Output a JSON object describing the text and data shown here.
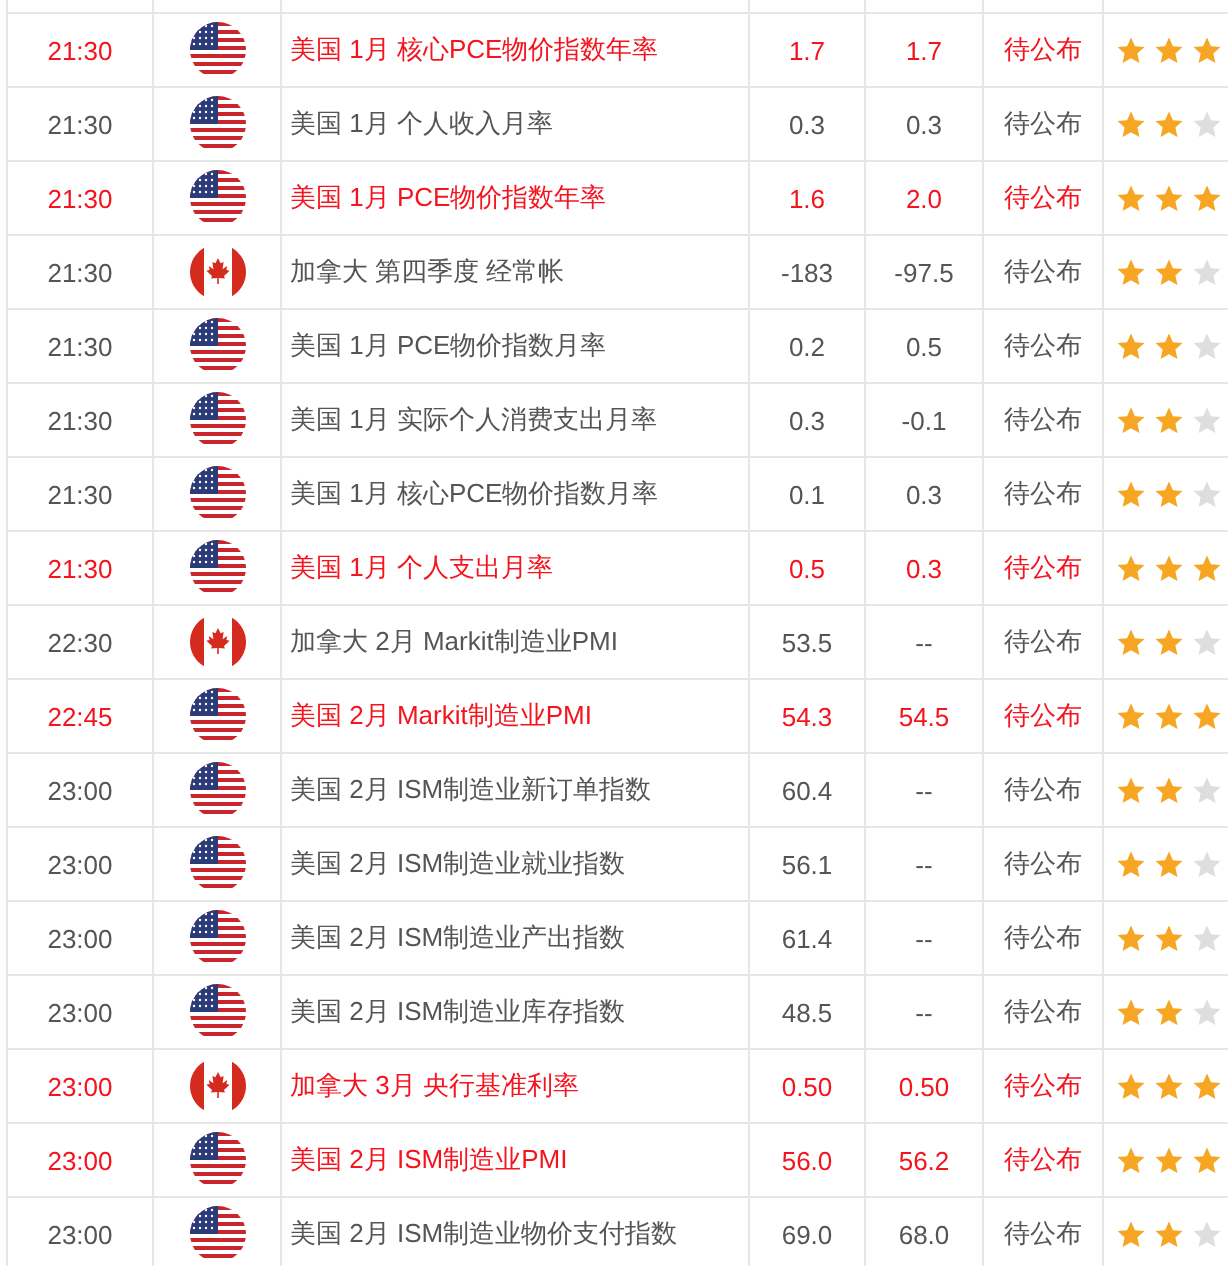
{
  "rows": [
    {
      "time": "21:30",
      "flag": {
        "kind": "us"
      },
      "event": "美国 1月 核心PCE物价指数年率",
      "previous": "1.7",
      "forecast": "1.7",
      "actual": "待公布",
      "important": true,
      "stars": 3
    },
    {
      "time": "21:30",
      "flag": {
        "kind": "us"
      },
      "event": "美国 1月 个人收入月率",
      "previous": "0.3",
      "forecast": "0.3",
      "actual": "待公布",
      "important": false,
      "stars": 2
    },
    {
      "time": "21:30",
      "flag": {
        "kind": "us"
      },
      "event": "美国 1月 PCE物价指数年率",
      "previous": "1.6",
      "forecast": "2.0",
      "actual": "待公布",
      "important": true,
      "stars": 3
    },
    {
      "time": "21:30",
      "flag": {
        "kind": "ca"
      },
      "event": "加拿大 第四季度 经常帐",
      "previous": "-183",
      "forecast": "-97.5",
      "actual": "待公布",
      "important": false,
      "stars": 2
    },
    {
      "time": "21:30",
      "flag": {
        "kind": "us"
      },
      "event": "美国 1月 PCE物价指数月率",
      "previous": "0.2",
      "forecast": "0.5",
      "actual": "待公布",
      "important": false,
      "stars": 2
    },
    {
      "time": "21:30",
      "flag": {
        "kind": "us"
      },
      "event": "美国 1月 实际个人消费支出月率",
      "previous": "0.3",
      "forecast": "-0.1",
      "actual": "待公布",
      "important": false,
      "stars": 2
    },
    {
      "time": "21:30",
      "flag": {
        "kind": "us"
      },
      "event": "美国 1月 核心PCE物价指数月率",
      "previous": "0.1",
      "forecast": "0.3",
      "actual": "待公布",
      "important": false,
      "stars": 2
    },
    {
      "time": "21:30",
      "flag": {
        "kind": "us"
      },
      "event": "美国 1月 个人支出月率",
      "previous": "0.5",
      "forecast": "0.3",
      "actual": "待公布",
      "important": true,
      "stars": 3
    },
    {
      "time": "22:30",
      "flag": {
        "kind": "ca"
      },
      "event": "加拿大 2月 Markit制造业PMI",
      "previous": "53.5",
      "forecast": "--",
      "actual": "待公布",
      "important": false,
      "stars": 2
    },
    {
      "time": "22:45",
      "flag": {
        "kind": "us"
      },
      "event": "美国 2月 Markit制造业PMI",
      "previous": "54.3",
      "forecast": "54.5",
      "actual": "待公布",
      "important": true,
      "stars": 3
    },
    {
      "time": "23:00",
      "flag": {
        "kind": "us"
      },
      "event": "美国 2月 ISM制造业新订单指数",
      "previous": "60.4",
      "forecast": "--",
      "actual": "待公布",
      "important": false,
      "stars": 2
    },
    {
      "time": "23:00",
      "flag": {
        "kind": "us"
      },
      "event": "美国 2月 ISM制造业就业指数",
      "previous": "56.1",
      "forecast": "--",
      "actual": "待公布",
      "important": false,
      "stars": 2
    },
    {
      "time": "23:00",
      "flag": {
        "kind": "us"
      },
      "event": "美国 2月 ISM制造业产出指数",
      "previous": "61.4",
      "forecast": "--",
      "actual": "待公布",
      "important": false,
      "stars": 2
    },
    {
      "time": "23:00",
      "flag": {
        "kind": "us"
      },
      "event": "美国 2月 ISM制造业库存指数",
      "previous": "48.5",
      "forecast": "--",
      "actual": "待公布",
      "important": false,
      "stars": 2
    },
    {
      "time": "23:00",
      "flag": {
        "kind": "ca"
      },
      "event": "加拿大 3月 央行基准利率",
      "previous": "0.50",
      "forecast": "0.50",
      "actual": "待公布",
      "important": true,
      "stars": 3
    },
    {
      "time": "23:00",
      "flag": {
        "kind": "us"
      },
      "event": "美国 2月 ISM制造业PMI",
      "previous": "56.0",
      "forecast": "56.2",
      "actual": "待公布",
      "important": true,
      "stars": 3
    },
    {
      "time": "23:00",
      "flag": {
        "kind": "us"
      },
      "event": "美国 2月 ISM制造业物价支付指数",
      "previous": "69.0",
      "forecast": "68.0",
      "actual": "待公布",
      "important": false,
      "stars": 2
    }
  ]
}
